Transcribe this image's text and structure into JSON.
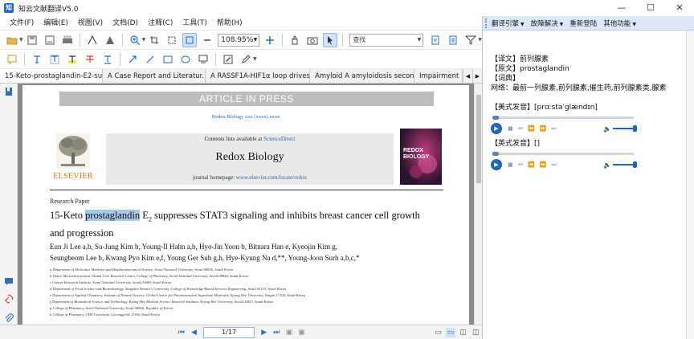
{
  "window": {
    "title": "知云文献翻译V5.0",
    "app_icon_letter": "知"
  },
  "menu": [
    "文件(F)",
    "编辑(E)",
    "视图(V)",
    "文档(D)",
    "注释(C)",
    "工具(T)",
    "帮助(H)"
  ],
  "toolbar": {
    "zoom_value": "108.95%",
    "find_placeholder": "查找"
  },
  "tabs": [
    "15-Keto-prostaglandin-E2-su...",
    "A Case Report and Literatur...",
    "A RASSF1A-HIF1α loop drives...",
    "Amyloid A amyloidosis secon...",
    "Impairment"
  ],
  "document": {
    "banner_top": "ARTICLE IN PRESS",
    "journal_ref": "Redox Biology xxx (xxxx) xxxx",
    "contents_prefix": "Contents lists available at",
    "contents_link": "ScienceDirect",
    "journal_name": "Redox Biology",
    "homepage_prefix": "journal homepage:",
    "homepage_url": "www.elsevier.com/locate/redox",
    "publisher": "ELSEVIER",
    "cover_title": "REDOX\nBIOLOGY",
    "research_type": "Research Paper",
    "title_pre": "15-Keto ",
    "title_highlight": "prostaglandin",
    "title_post_e": " E",
    "title_sub": "2",
    "title_rest": " suppresses STAT3 signaling and inhibits breast cancer cell growth and progression",
    "authors_line1": "Eun Ji Lee a,b, Su-Jung Kim b, Young-Il Hahn a,b, Hyo-Jin Yoon b, Bitnara Han e, Kyeojin Kim g,",
    "authors_line2": "Seungbeom Lee b, Kwang Pyo Kim e,f, Young Ger Suh g,h, Hye-Kyung Na d,**, Young-Joon Surh a,b,c,*",
    "affiliations": [
      "a Department of Molecular Medicine and Biopharmaceutical Science, Seoul National University, Seoul 08826, South Korea",
      "b Tumor Microenvironment Global Core Research Center, College of Pharmacy, Seoul National University, Seoul 08826, South Korea",
      "c Cancer Research Institute, Seoul National University, Seoul 03080, South Korea",
      "d Department of Food Science and Biotechnology, Sungshin Women's University, College of Knowledge-Based Services Engineering, Seoul 01133, South Korea",
      "e Department of Applied Chemistry, Institute of Natural Science, Global Center for Pharmaceutical Ingredient Materials, Kyung Hee University, Yongin 17104, South Korea",
      "f Department of Biomedical Science and Technology, Kyung Hee Medical Science Research Institute, Kyung Hee University, Seoul 02453, South Korea",
      "g College of Pharmacy, Seoul National University, Seoul 08826, Republic of Korea",
      "h College of Pharmacy, CHA University, Gyeonggi-do 11160, South Korea"
    ]
  },
  "status": {
    "page": "1/17"
  },
  "right_panel": {
    "menu": [
      "翻译引擎",
      "故障解决",
      "重新登陆",
      "其他功能"
    ],
    "translation_label": "【译文】",
    "translation": "前列腺素",
    "original_label": "【原文】",
    "original": "prostaglandin",
    "dict_label": "【词典】",
    "dict_text": "网络：最前一列腺素,前列腺素,催生药,前列腺素类,腺素",
    "us_label": "【美式发音】",
    "us_phonetic": "[prɑːstəˈglændɪn]",
    "uk_label": "【英式发音】",
    "uk_phonetic": "[]"
  },
  "colors": {
    "accent": "#1f64c0",
    "highlight": "#a9c9ea",
    "elsevier_orange": "#e9711c"
  }
}
